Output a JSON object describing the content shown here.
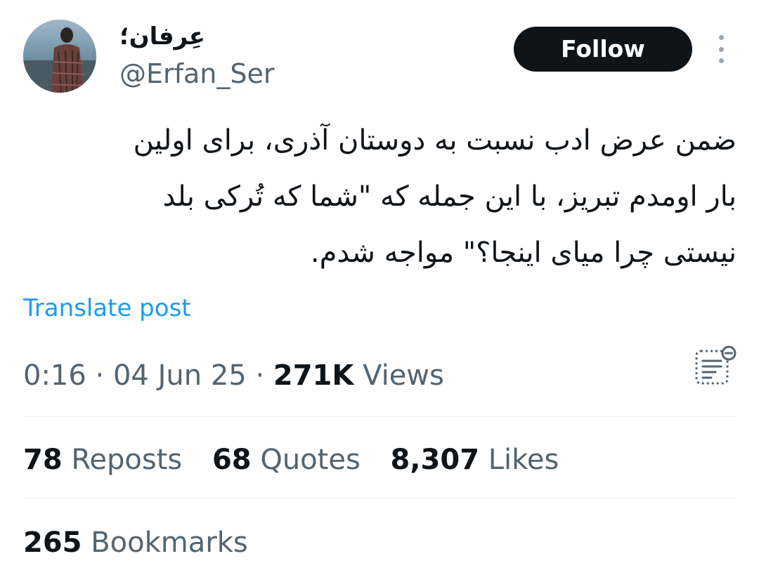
{
  "author": {
    "display_name": "عِرفان؛",
    "handle": "@Erfan_Ser"
  },
  "follow_button": {
    "label": "Follow"
  },
  "tweet": {
    "text": "ضمن عرض ادب نسبت به دوستان آذری، برای اولین\nبار اومدم تبریز، با این جمله که \"شما که تُرکی بلد\nنیستی چرا میای اینجا؟\" مواجه شدم."
  },
  "translate": {
    "label": "Translate post"
  },
  "meta": {
    "time": "0:16",
    "separator": "·",
    "date": "04 Jun 25",
    "views_count": "271K",
    "views_label": "Views"
  },
  "stats": {
    "reposts": {
      "count": "78",
      "label": "Reposts"
    },
    "quotes": {
      "count": "68",
      "label": "Quotes"
    },
    "likes": {
      "count": "8,307",
      "label": "Likes"
    },
    "bookmarks": {
      "count": "265",
      "label": "Bookmarks"
    }
  },
  "icons": {
    "more": "more-vertical-icon",
    "analytics": "post-analytics-icon"
  },
  "colors": {
    "text_primary": "#0f1419",
    "text_secondary": "#536471",
    "link": "#1d9bf0",
    "button_bg": "#0f1419",
    "button_text": "#ffffff",
    "divider": "#eff3f4"
  }
}
